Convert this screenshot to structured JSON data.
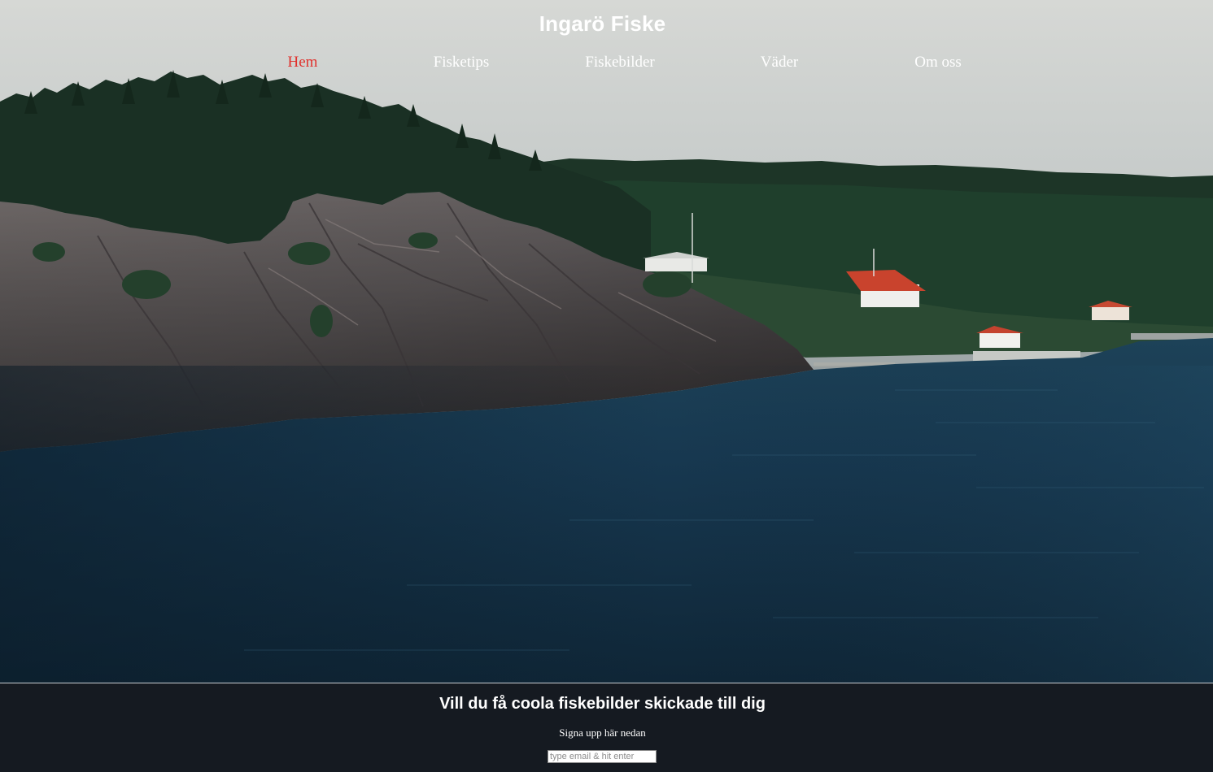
{
  "site": {
    "title": "Ingarö Fiske"
  },
  "nav": {
    "items": [
      {
        "label": "Hem",
        "active": true
      },
      {
        "label": "Fisketips",
        "active": false
      },
      {
        "label": "Fiskebilder",
        "active": false
      },
      {
        "label": "Väder",
        "active": false
      },
      {
        "label": "Om oss",
        "active": false
      }
    ]
  },
  "hero": {
    "image": "landscape-photo: forested granite cliff over dark lake with red-roofed houses"
  },
  "signup": {
    "title": "Vill du få coola fiskebilder skickade till dig",
    "subtitle": "Signa upp här nedan",
    "email_placeholder": "type email & hit enter",
    "email_value": ""
  },
  "colors": {
    "active_nav": "#e0302c",
    "footer_bg": "#151a21",
    "water": "#14344a"
  }
}
